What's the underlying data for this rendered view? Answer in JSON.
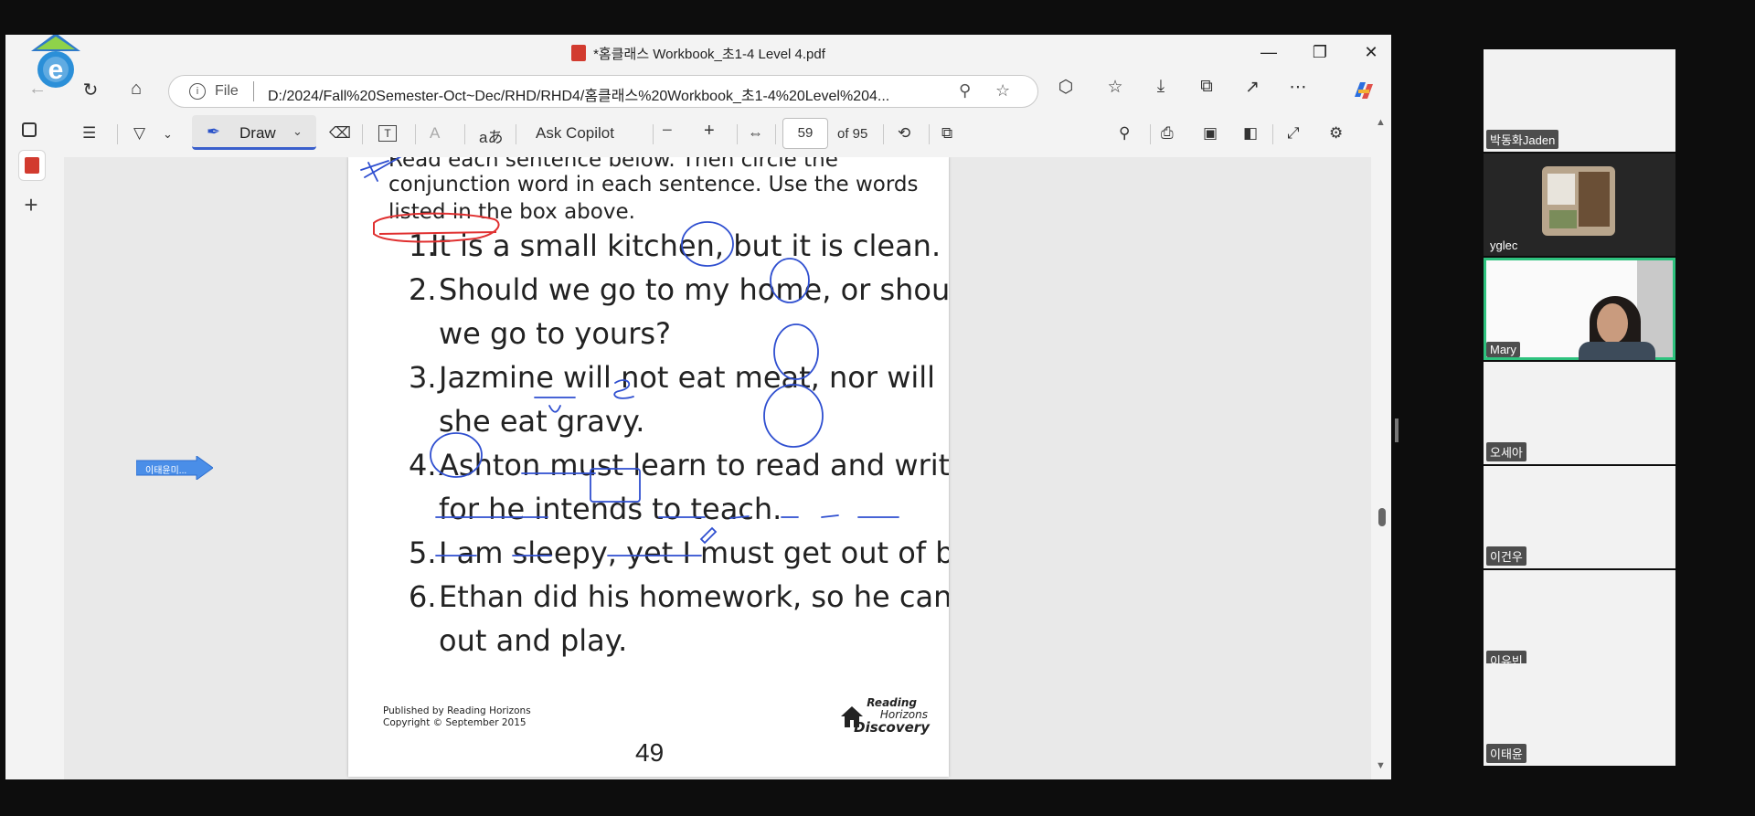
{
  "window": {
    "title": "*홈클래스 Workbook_초1-4 Level 4.pdf",
    "minimize_glyph": "—",
    "restore_glyph": "❐",
    "close_glyph": "✕"
  },
  "address_bar": {
    "scheme_label": "File",
    "url": "D:/2024/Fall%20Semester-Oct~Dec/RHD/RHD4/홈클래스%20Workbook_초1-4%20Level%204..."
  },
  "pdf_toolbar": {
    "draw_label": "Draw",
    "ask_copilot_label": "Ask Copilot",
    "page_number": "59",
    "page_total": "of 95",
    "aa_label": "aあ",
    "read_aloud_label": "A"
  },
  "page": {
    "instruction_lines": [
      "Read each sentence below. Then circle the",
      "conjunction word in each sentence. Use the words",
      "listed in the box above."
    ],
    "sentences": [
      {
        "num": "1.",
        "lines": [
          "It is a small kitchen, but it is clean."
        ]
      },
      {
        "num": "2.",
        "lines": [
          "Should we go to my home, or should",
          "we go to yours?"
        ]
      },
      {
        "num": "3.",
        "lines": [
          "Jazmine will not eat meat, nor will",
          "she eat gravy."
        ]
      },
      {
        "num": "4.",
        "lines": [
          "Ashton must learn to read and write,",
          "for he intends to teach."
        ]
      },
      {
        "num": "5.",
        "lines": [
          "I am sleepy, yet I must get out of bed."
        ]
      },
      {
        "num": "6.",
        "lines": [
          "Ethan did his homework, so he can go",
          "out and play."
        ]
      }
    ],
    "publisher_lines": [
      "Published by Reading Horizons",
      "Copyright © September 2015"
    ],
    "page_number": "49",
    "brand_lines": [
      "Reading",
      "Horizons",
      "Discovery"
    ]
  },
  "annotation_tag": "이태윤미...",
  "participants": [
    {
      "name": "박동화",
      "extra": "Jaden"
    },
    {
      "name": "yglec"
    },
    {
      "name": "Mary"
    },
    {
      "name": "오세아"
    },
    {
      "name": "이건우"
    },
    {
      "name": "이유빈"
    },
    {
      "name": "이태윤"
    }
  ],
  "colors": {
    "ink_blue": "#2f4fd0",
    "ink_red": "#e03030",
    "active_speaker": "#2ec27e",
    "draw_accent": "#3a5fcc"
  }
}
